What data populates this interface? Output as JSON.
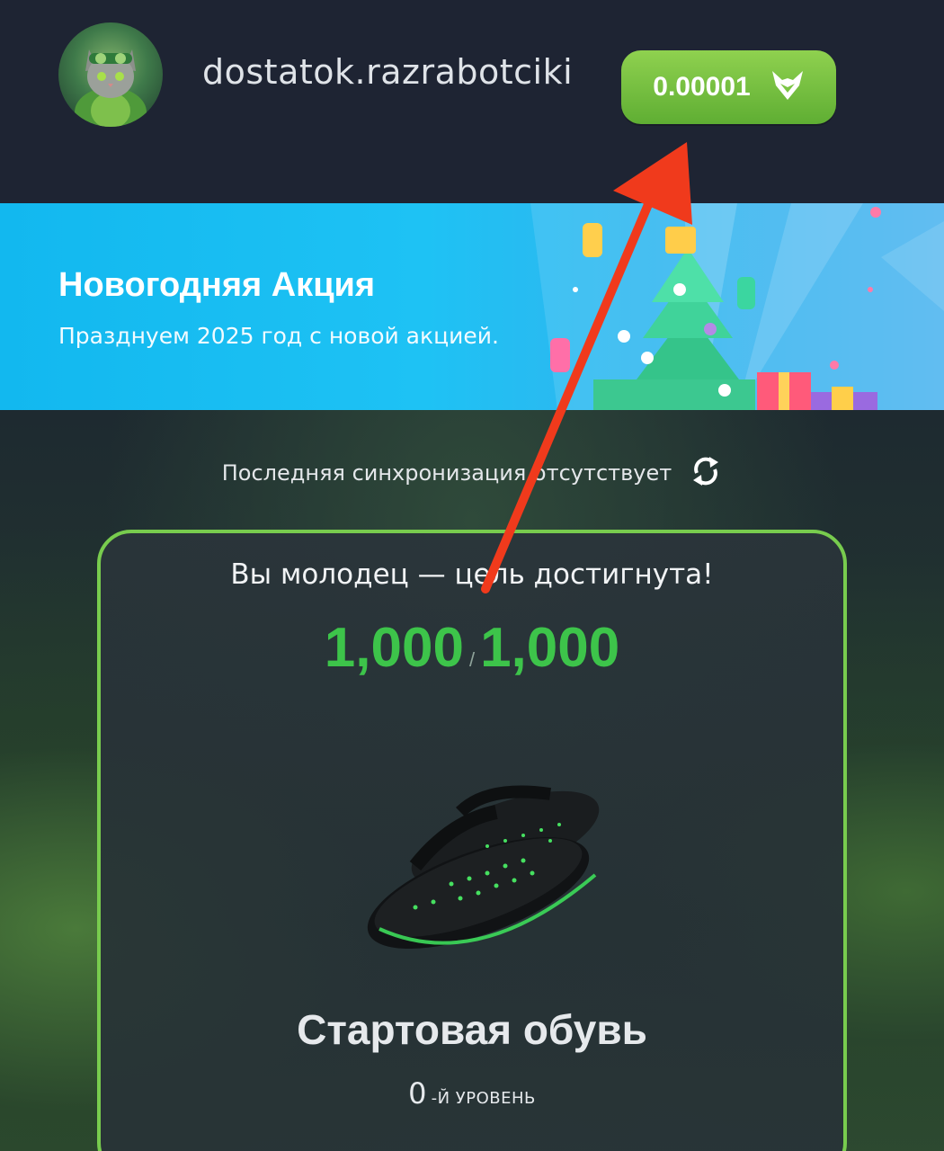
{
  "header": {
    "username": "dostatok.razrabotciki",
    "balance": "0.00001",
    "avatar_icon": "cat-pilot-avatar-icon",
    "currency_icon": "fox-head-icon"
  },
  "banner": {
    "title": "Новогодняя Акция",
    "subtitle": "Празднуем 2025 год с новой акцией."
  },
  "sync": {
    "text": "Последняя синхронизация отсутствует",
    "icon": "sync-icon"
  },
  "card": {
    "goal_text": "Вы молодец — цель достигнута!",
    "progress_current": "1,000",
    "progress_separator": "/",
    "progress_target": "1,000",
    "item_name": "Стартовая обувь",
    "level_number": "0",
    "level_label": "-Й УРОВЕНЬ"
  },
  "colors": {
    "accent_green": "#3dc44a",
    "button_green": "#7cc545",
    "card_border": "#78cc4e",
    "banner_blue": "#1ec2f4",
    "arrow_red": "#f03a1c"
  }
}
